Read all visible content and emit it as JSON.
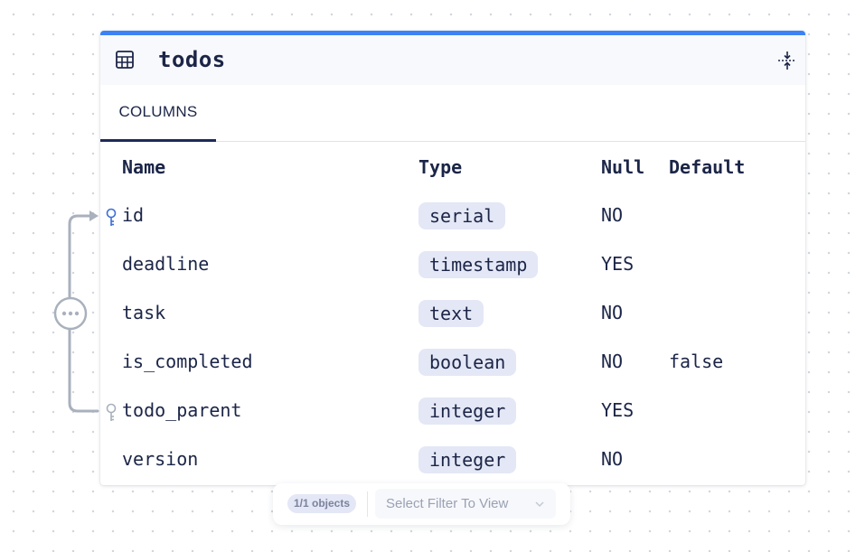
{
  "table": {
    "name": "todos",
    "accent_color": "#3b82f6",
    "icon": "table-icon",
    "collapse_icon": "collapse-icon"
  },
  "tabs": [
    {
      "label": "COLUMNS",
      "active": true
    }
  ],
  "columns_header": {
    "name": "Name",
    "type": "Type",
    "null": "Null",
    "default": "Default"
  },
  "columns": [
    {
      "name": "id",
      "type": "serial",
      "null": "NO",
      "default": "",
      "key": "primary-key"
    },
    {
      "name": "deadline",
      "type": "timestamp",
      "null": "YES",
      "default": ""
    },
    {
      "name": "task",
      "type": "text",
      "null": "NO",
      "default": ""
    },
    {
      "name": "is_completed",
      "type": "boolean",
      "null": "NO",
      "default": "false"
    },
    {
      "name": "todo_parent",
      "type": "integer",
      "null": "YES",
      "default": "",
      "key": "foreign-key"
    },
    {
      "name": "version",
      "type": "integer",
      "null": "NO",
      "default": ""
    }
  ],
  "relation": {
    "from": "todo_parent",
    "to": "id",
    "handle_icon": "ellipsis-icon",
    "line_color": "#a9b1bd"
  },
  "filter_bar": {
    "objects_badge": "1/1 objects",
    "filter_placeholder": "Select Filter To View"
  }
}
